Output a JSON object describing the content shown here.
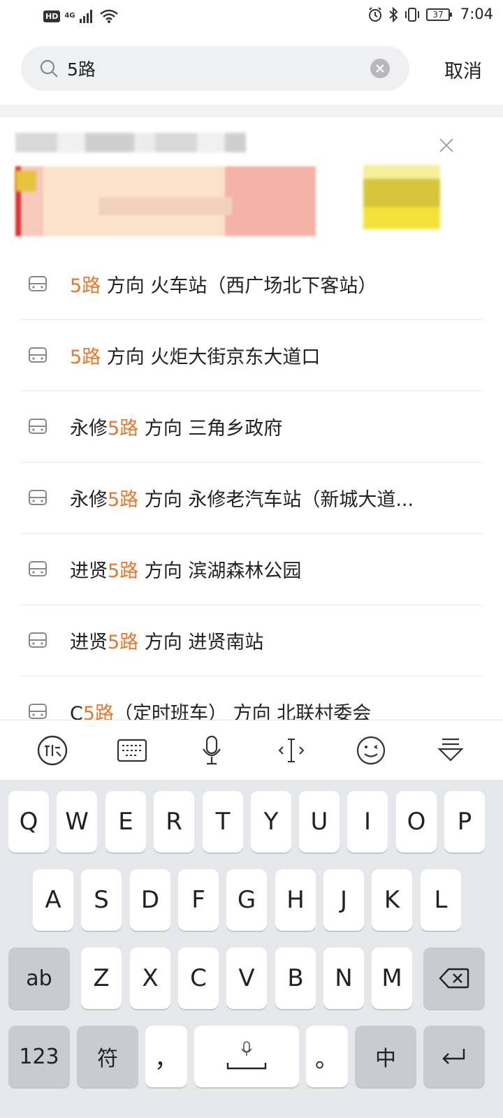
{
  "status_bar": {
    "hd": "HD",
    "network": "4G",
    "battery": "37",
    "time": "7:04"
  },
  "search": {
    "query": "5路",
    "cancel_label": "取消"
  },
  "results": [
    {
      "prefix": "",
      "highlight": "5路",
      "suffix": " 方向 火车站（西广场北下客站）"
    },
    {
      "prefix": "",
      "highlight": "5路",
      "suffix": " 方向 火炬大街京东大道口"
    },
    {
      "prefix": "永修",
      "highlight": "5路",
      "suffix": " 方向 三角乡政府"
    },
    {
      "prefix": "永修",
      "highlight": "5路",
      "suffix": " 方向 永修老汽车站（新城大道..."
    },
    {
      "prefix": "进贤",
      "highlight": "5路",
      "suffix": " 方向 滨湖森林公园"
    },
    {
      "prefix": "进贤",
      "highlight": "5路",
      "suffix": " 方向 进贤南站"
    },
    {
      "prefix": "C",
      "highlight": "5路",
      "suffix": "（定时班车） 方向 北联村委会"
    }
  ],
  "keyboard": {
    "row1": [
      "Q",
      "W",
      "E",
      "R",
      "T",
      "Y",
      "U",
      "I",
      "O",
      "P"
    ],
    "row2": [
      "A",
      "S",
      "D",
      "F",
      "G",
      "H",
      "J",
      "K",
      "L"
    ],
    "row3": [
      "Z",
      "X",
      "C",
      "V",
      "B",
      "N",
      "M"
    ],
    "ab": "ab",
    "num": "123",
    "symbol": "符",
    "comma": "，",
    "period": "。",
    "lang": "中"
  },
  "colors": {
    "highlight": "#e8772e",
    "search_bg": "#eff0f2",
    "keyboard_bg": "#e6e7eb"
  }
}
